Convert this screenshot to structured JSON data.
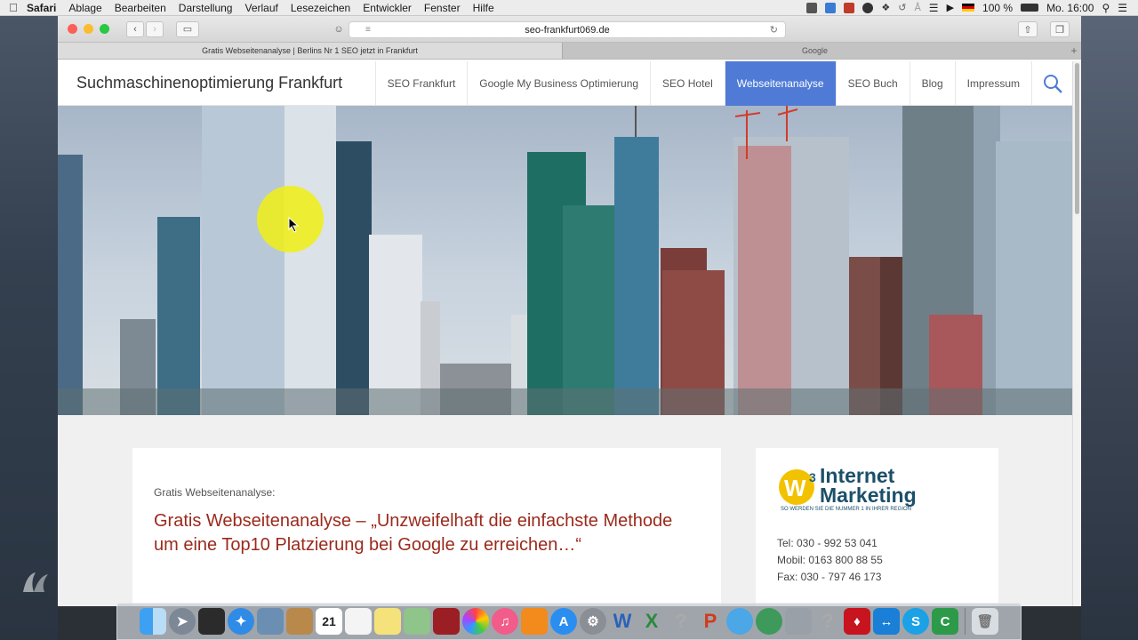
{
  "menubar": {
    "app": "Safari",
    "items": [
      "Ablage",
      "Bearbeiten",
      "Darstellung",
      "Verlauf",
      "Lesezeichen",
      "Entwickler",
      "Fenster",
      "Hilfe"
    ],
    "battery": "100 %",
    "clock": "Mo. 16:00"
  },
  "browser": {
    "url": "seo-frankfurt069.de",
    "tabs": [
      {
        "label": "Gratis Webseitenanalyse | Berlins Nr 1 SEO jetzt in Frankfurt"
      },
      {
        "label": "Google"
      }
    ]
  },
  "site": {
    "title": "Suchmaschinenoptimierung Frankfurt",
    "nav": [
      "SEO Frankfurt",
      "Google My Business Optimierung",
      "SEO Hotel",
      "Webseitenanalyse",
      "SEO Buch",
      "Blog",
      "Impressum"
    ],
    "active_nav": "Webseitenanalyse",
    "accent_color": "#4f7bd6"
  },
  "article": {
    "kicker": "Gratis Webseitenanalyse:",
    "headline": "Gratis Webseitenanalyse – „Unzweifelhaft die einfachste Methode um eine Top10 Platzierung bei Google zu erreichen…“"
  },
  "sidebar": {
    "logo_line1": "Internet",
    "logo_line2": "Marketing",
    "logo_tagline": "SO WERDEN SIE DIE NUMMER 1 IN IHRER REGION",
    "phone": "Tel: 030 - 992 53 041",
    "mobile": "Mobil: 0163 800 88 55",
    "fax": "Fax: 030 - 797 46 173"
  },
  "dock": {
    "calendar_day": "21",
    "icons": [
      "finder-icon",
      "launchpad-icon",
      "mission-control-icon",
      "safari-icon",
      "preview-icon",
      "contacts-icon",
      "calendar-icon",
      "reminders-icon",
      "notes-icon",
      "maps-icon",
      "photo-booth-icon",
      "photos-icon",
      "itunes-icon",
      "ibooks-icon",
      "app-store-icon",
      "system-preferences-icon",
      "word-icon",
      "excel-icon",
      "unknown-app-icon",
      "powerpoint-icon",
      "messenger-icon",
      "network-icon",
      "utility-icon",
      "unknown-app-icon-2",
      "acrobat-icon",
      "teamviewer-icon",
      "skype-icon",
      "camtasia-icon",
      "trash-icon"
    ]
  }
}
